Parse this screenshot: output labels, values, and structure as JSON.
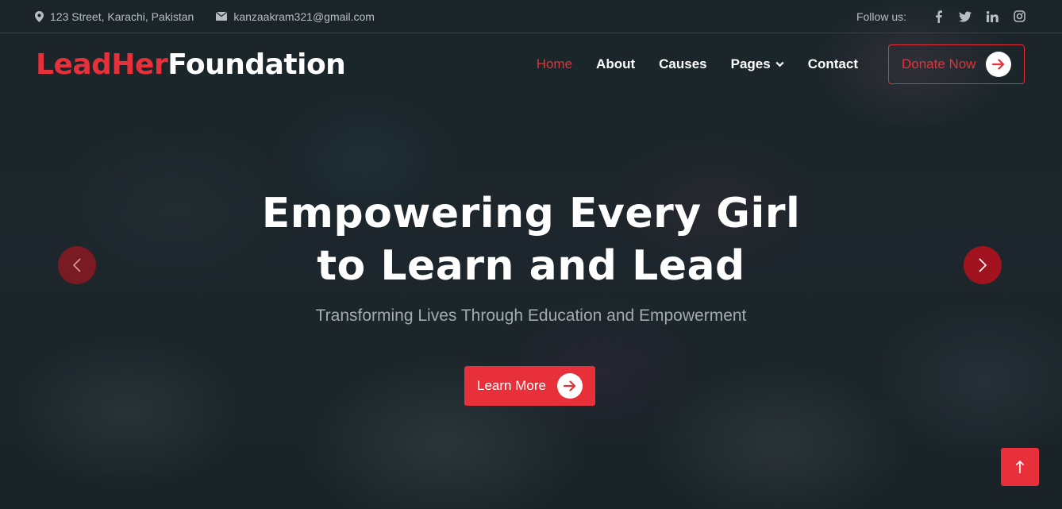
{
  "topbar": {
    "address": "123 Street, Karachi, Pakistan",
    "email": "kanzaakram321@gmail.com",
    "follow_label": "Follow us:",
    "social": [
      "facebook-icon",
      "twitter-icon",
      "linkedin-icon",
      "instagram-icon"
    ]
  },
  "brand": {
    "part1": "LeadHer",
    "part2": "Foundation",
    "accent_color": "#e8303a"
  },
  "nav": {
    "items": [
      {
        "label": "Home",
        "active": true
      },
      {
        "label": "About"
      },
      {
        "label": "Causes"
      },
      {
        "label": "Pages",
        "dropdown": true
      },
      {
        "label": "Contact"
      }
    ],
    "donate_label": "Donate Now"
  },
  "hero": {
    "title_line1": "Empowering Every Girl",
    "title_line2": "to Learn and Lead",
    "subtitle": "Transforming Lives Through Education and Empowerment",
    "cta_label": "Learn More"
  }
}
